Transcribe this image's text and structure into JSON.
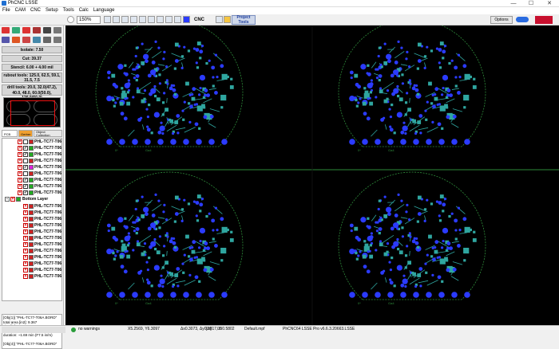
{
  "window": {
    "title": "PhCNC LSSE",
    "minimize": "—",
    "maximize": "☐",
    "close": "✕"
  },
  "menu": [
    "File",
    "CAM",
    "CNC",
    "Setup",
    "Tools",
    "Calc",
    "Language"
  ],
  "toolbar": {
    "zoom_value": "150%",
    "cnc_label": "CNC",
    "project_tools_label_1": "Project",
    "project_tools_label_2": "Tools",
    "options_label": "Options"
  },
  "left_panel": {
    "isolate_label": "Isolate: 7.50",
    "cut_label": "Cut: 39.37",
    "stencil_label": "Stencil: 6.00 + 4.00 mil",
    "rubout_label": "rubout tools: 125.0, 62.5, 59.1, 31.5, 7.5",
    "drill_label": "drill tools: 20.0, 32.0(47.2), 40.0, 48.0, 60.0(50.0), 120.0(50.0)",
    "tabs": [
      "PCB",
      "Gerber",
      "Object Collection"
    ],
    "layer_rows": [
      {
        "label": "PHL-TC77-T06A",
        "checked": false
      },
      {
        "label": "PHL-TC77-T06A",
        "checked": true
      },
      {
        "label": "PHL-TC77-T06A",
        "checked": true
      },
      {
        "label": "PHL-TC77-T06A",
        "checked": false
      },
      {
        "label": "PHL-TC77-T06A",
        "checked": true
      },
      {
        "label": "PHL-TC77-T06A",
        "checked": false
      },
      {
        "label": "PHL-TC77-T06A",
        "checked": true
      },
      {
        "label": "PHL-TC77-T06A",
        "checked": true
      },
      {
        "label": "PHL-TC77-T06A",
        "checked": true
      }
    ],
    "bottom_layer_label": "Bottom Layer",
    "bottom_rows": [
      "PHL-TC77-T06A",
      "PHL-TC77-T06A",
      "PHL-TC77-T06A",
      "PHL-TC77-T06A",
      "PHL-TC77-T06A",
      "PHL-TC77-T06A",
      "PHL-TC77-T06A",
      "PHL-TC77-T06A",
      "PHL-TC77-T06A",
      "PHL-TC77-T06A",
      "PHL-TC77-T06A",
      "PHL-TC77-T06A"
    ],
    "info_lines": [
      "[Obj(1)] \"PHL-TC77-T06A.BORD\"",
      "total area [in2]: 9.367",
      "size [in]: 3.552 x 2.637",
      "tool path: 10.40 in",
      "duration: ~1.69 min (F7.5 in/m)",
      "",
      "[Obj(4)] \"PHL-TC77-T06A.BORD\""
    ]
  },
  "statusbar": {
    "warnings": "no warnings",
    "coords": "X5.2569, Y6.3097",
    "delta": "Δx0.3073, Δy0.2817, Δl0.5802",
    "unit": "[in]",
    "angle": "0°",
    "file": "Default.mpf",
    "version": "PhCNC64 LSSE Pro v6.6.3.20663.LSSE"
  },
  "colors": {
    "canvas_bg": "#000000",
    "board_outline": "#2e8b3a",
    "pad_fill": "#2b3bff",
    "trace": "#2fa6a0",
    "panel_divider": "#2e8b3a"
  },
  "board_labels": [
    "0*",
    "Ga4"
  ]
}
